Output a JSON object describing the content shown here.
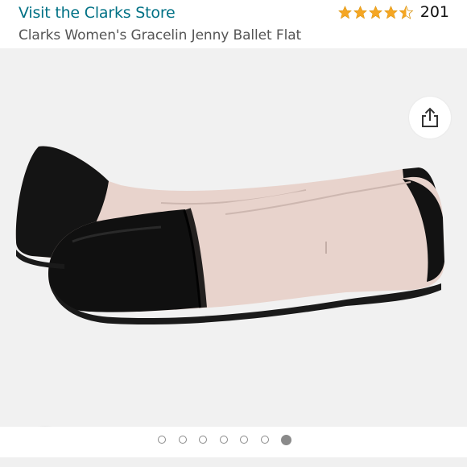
{
  "header": {
    "store_link": "Visit the Clarks Store",
    "product_title": "Clarks Women's Gracelin Jenny Ballet Flat",
    "rating": {
      "stars": 4.5,
      "count": "201",
      "star_color": "#F5A623"
    }
  },
  "gallery": {
    "image_count": 7,
    "active_index": 6,
    "background": "#F1F1F1"
  },
  "actions": {
    "share_icon": "share-icon",
    "wishlist_icon": "heart-outline-icon"
  },
  "colors": {
    "link": "#007185",
    "shoe_leather": "#E8D3CC",
    "shoe_toe": "#111111"
  }
}
